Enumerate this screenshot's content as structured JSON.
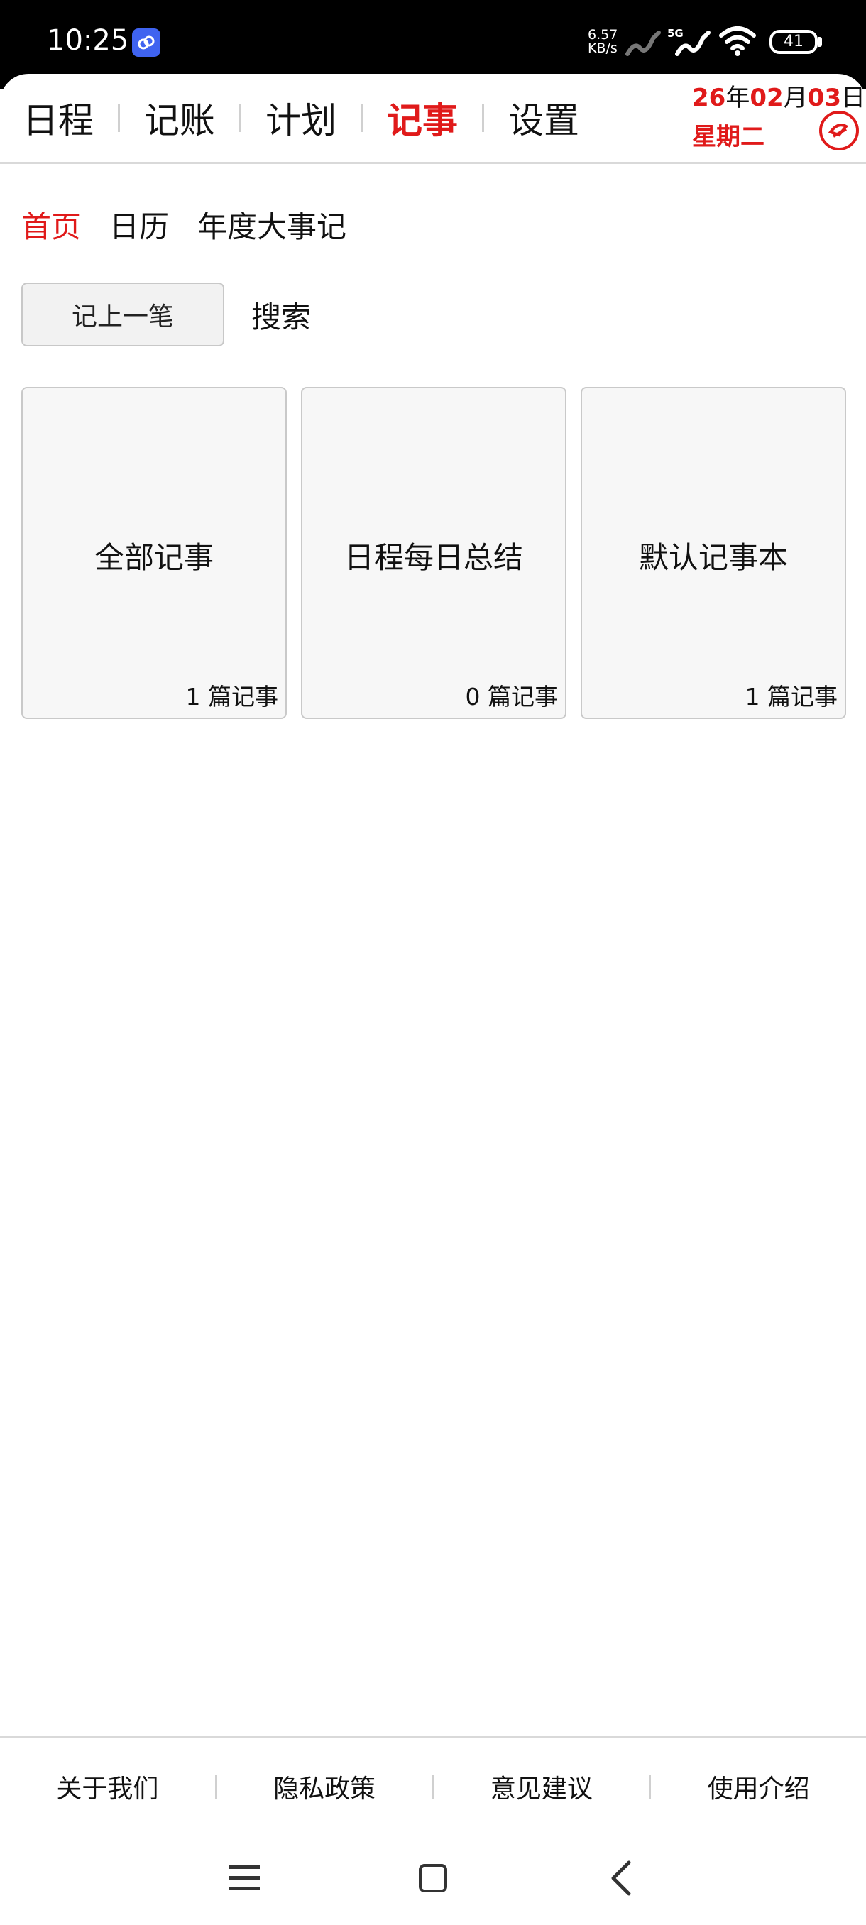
{
  "status_bar": {
    "time": "10:25",
    "net_speed_value": "6.57",
    "net_speed_unit": "KB/s",
    "network_label": "5G",
    "battery": "41",
    "icons": [
      "app-icon",
      "signal-icon",
      "signal-5g-icon",
      "wifi-icon",
      "battery-icon"
    ]
  },
  "header": {
    "tabs": [
      {
        "label": "日程"
      },
      {
        "label": "记账"
      },
      {
        "label": "计划"
      },
      {
        "label": "记事",
        "active": true
      },
      {
        "label": "设置"
      }
    ],
    "date": {
      "year": "26",
      "year_suffix": "年",
      "month": "02",
      "month_suffix": "月",
      "day": "03",
      "day_suffix": "日",
      "weekday": "星期二"
    },
    "accent_color": "#e01a1a"
  },
  "subnav": {
    "items": [
      {
        "label": "首页",
        "active": true
      },
      {
        "label": "日历"
      },
      {
        "label": "年度大事记"
      }
    ]
  },
  "actions": {
    "new_note_label": "记上一笔",
    "search_label": "搜索"
  },
  "notebooks": [
    {
      "title": "全部记事",
      "count": "1 篇记事"
    },
    {
      "title": "日程每日总结",
      "count": "0 篇记事"
    },
    {
      "title": "默认记事本",
      "count": "1 篇记事"
    }
  ],
  "footer": {
    "links": [
      {
        "label": "关于我们"
      },
      {
        "label": "隐私政策"
      },
      {
        "label": "意见建议"
      },
      {
        "label": "使用介绍"
      }
    ]
  }
}
